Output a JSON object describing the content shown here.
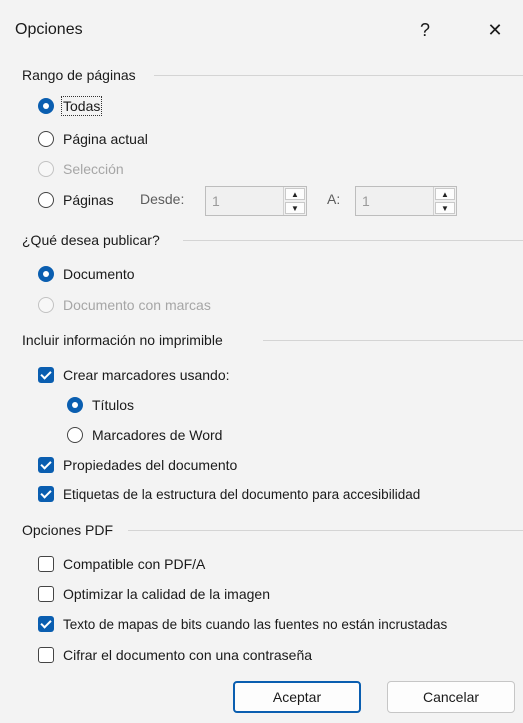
{
  "dialog": {
    "title": "Opciones",
    "help_glyph": "?",
    "close_glyph": "✕"
  },
  "range": {
    "label": "Rango de páginas",
    "all": "Todas",
    "current": "Página actual",
    "selection": "Selección",
    "pages": "Páginas",
    "from_label": "Desde:",
    "from_value": "1",
    "to_label": "A:",
    "to_value": "1"
  },
  "publish": {
    "label": "¿Qué desea publicar?",
    "document": "Documento",
    "document_markup": "Documento con marcas"
  },
  "nonprint": {
    "label": "Incluir información no imprimible",
    "bookmarks": "Crear marcadores usando:",
    "headings": "Títulos",
    "word_bookmarks": "Marcadores de Word",
    "properties": "Propiedades del documento",
    "structure_tags": "Etiquetas de la estructura del documento para accesibilidad"
  },
  "pdf": {
    "label": "Opciones PDF",
    "pdfa": "Compatible con PDF/A",
    "optimize": "Optimizar la calidad de la imagen",
    "bitmap": "Texto de mapas de bits cuando las fuentes no están incrustadas",
    "encrypt": "Cifrar el documento con una contraseña"
  },
  "buttons": {
    "ok": "Aceptar",
    "cancel": "Cancelar"
  },
  "colors": {
    "accent": "#0a5eb0",
    "background": "#f3f3f3"
  }
}
